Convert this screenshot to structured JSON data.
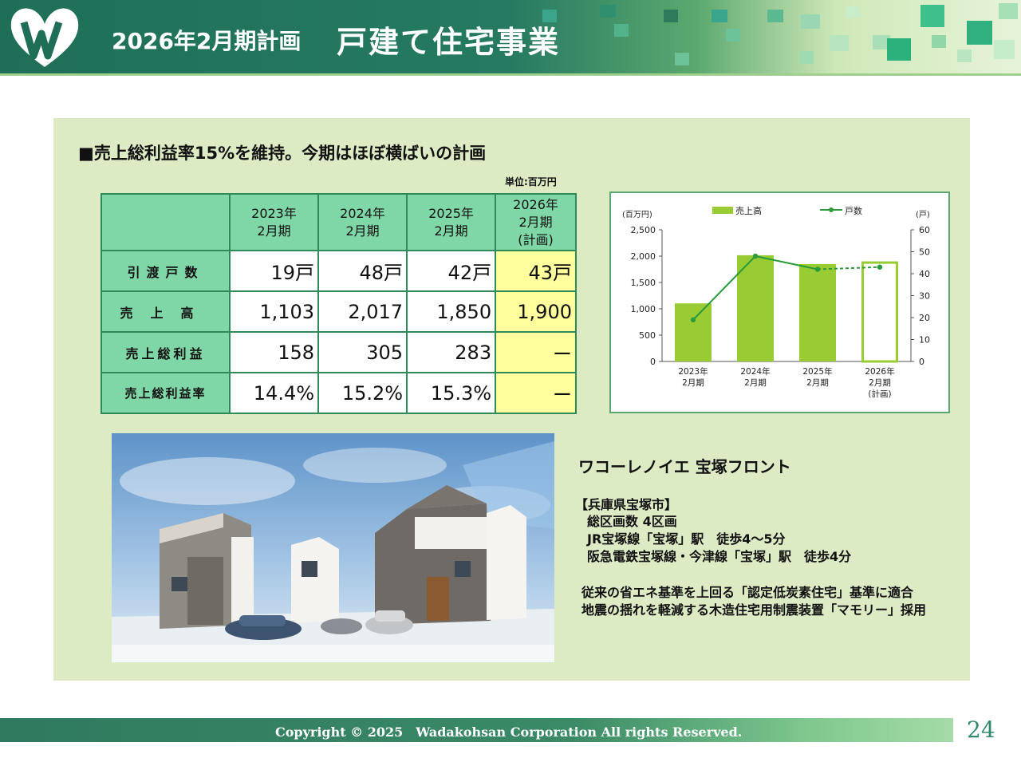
{
  "header": {
    "title_left": "2026年2月期計画",
    "title_right": "戸建て住宅事業"
  },
  "headline": "■売上総利益率15%を維持。今期はほぼ横ばいの計画",
  "unit": "単位:百万円",
  "table": {
    "columns": [
      {
        "line1": "2023年",
        "line2": "2月期",
        "line3": ""
      },
      {
        "line1": "2024年",
        "line2": "2月期",
        "line3": ""
      },
      {
        "line1": "2025年",
        "line2": "2月期",
        "line3": ""
      },
      {
        "line1": "2026年",
        "line2": "2月期",
        "line3": "(計画)"
      }
    ],
    "rows": [
      {
        "label": "引渡戸数",
        "values": [
          "19戸",
          "48戸",
          "42戸",
          "43戸"
        ]
      },
      {
        "label": "売上高",
        "values": [
          "1,103",
          "2,017",
          "1,850",
          "1,900"
        ]
      },
      {
        "label": "売上総利益",
        "values": [
          "158",
          "305",
          "283",
          "ー"
        ]
      },
      {
        "label": "売上総利益率",
        "values": [
          "14.4%",
          "15.2%",
          "15.3%",
          "ー"
        ]
      }
    ]
  },
  "chart_data": {
    "type": "bar",
    "categories": [
      "2023年 2月期",
      "2024年 2月期",
      "2025年 2月期",
      "2026年 2月期 (計画)"
    ],
    "series": [
      {
        "name": "売上高",
        "type": "bar",
        "axis": "left",
        "values": [
          1103,
          2017,
          1850,
          1900
        ]
      },
      {
        "name": "戸数",
        "type": "line",
        "axis": "right",
        "values": [
          19,
          48,
          42,
          43
        ]
      }
    ],
    "ylabel_left": "(百万円)",
    "ylabel_right": "(戸)",
    "ylim_left": [
      0,
      2500
    ],
    "ylim_right": [
      0,
      60
    ],
    "yticks_left": [
      "0",
      "500",
      "1,000",
      "1,500",
      "2,000",
      "2,500"
    ],
    "yticks_right": [
      "0",
      "10",
      "20",
      "30",
      "40",
      "50",
      "60"
    ],
    "legend_position": "top",
    "colors": {
      "bar": "#99cc33",
      "line": "#2a9a3a"
    },
    "grid": false,
    "x_labels": [
      [
        "2023年",
        "2月期",
        ""
      ],
      [
        "2024年",
        "2月期",
        ""
      ],
      [
        "2025年",
        "2月期",
        ""
      ],
      [
        "2026年",
        "2月期",
        "(計画)"
      ]
    ]
  },
  "property": {
    "name": "ワコーレノイエ 宝塚フロント",
    "location": "【兵庫県宝塚市】",
    "lots": "総区画数 4区画",
    "access1": "JR宝塚線「宝塚」駅　徒歩4～5分",
    "access2": "阪急電鉄宝塚線・今津線「宝塚」駅　徒歩4分",
    "feature1": "従来の省エネ基準を上回る「認定低炭素住宅」基準に適合",
    "feature2": "地震の揺れを軽減する木造住宅用制震装置「マモリー」採用"
  },
  "footer": {
    "copyright": "Copyright © 2025　Wadakohsan Corporation All rights Reserved.",
    "page": "24"
  }
}
